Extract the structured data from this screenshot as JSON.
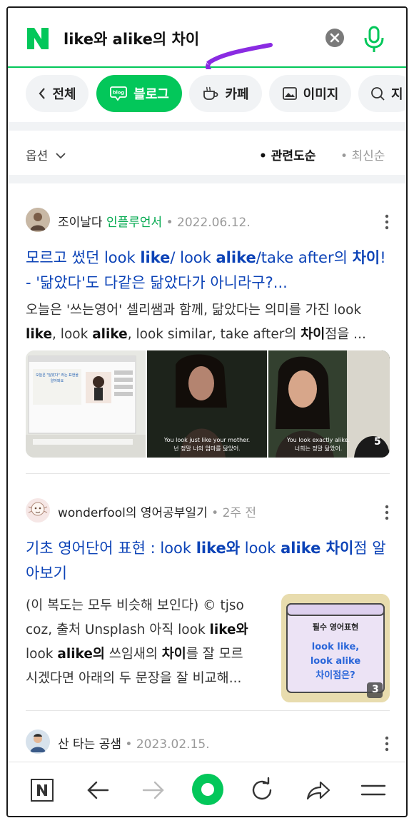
{
  "search": {
    "query": "like와 alike의 차이"
  },
  "tabs": [
    {
      "label": "전체",
      "icon": "chevron-left-icon"
    },
    {
      "label": "블로그",
      "icon": "blog-icon",
      "icon_text": "blog"
    },
    {
      "label": "카페",
      "icon": "cafe-icon"
    },
    {
      "label": "이미지",
      "icon": "image-icon"
    },
    {
      "label": "지",
      "icon": "search-icon"
    }
  ],
  "options": {
    "label": "옵션",
    "sort_relevance": "관련도순",
    "sort_recent": "최신순"
  },
  "results": [
    {
      "author": "조이날다",
      "badge": "인플루언서",
      "date": "2022.06.12.",
      "title_parts": [
        "모르고 썼던 look ",
        "like",
        "/ look ",
        "alike",
        "/take after의 ",
        "차이",
        "! - '닮았다'도 다같은 닮았다가 아니라구?..."
      ],
      "desc_parts": [
        "오늘은 '쓰는영어' 셀리쌤과 함께, 닮았다는 의미를 가진 look ",
        "like",
        ", look ",
        "alike",
        ", look similar, take after의 ",
        "차이",
        "점을 ..."
      ],
      "image_count": "5",
      "captions": [
        "You look just like your mother.",
        "넌 정말 너의 엄마를 닮았어.",
        "You look exactly alike.",
        "너희는 정말 닮았어."
      ],
      "slide_text": [
        "오늘은 \"닮았다\" 라는 표현을",
        "알아봐요"
      ]
    },
    {
      "author": "wonderfool의 영어공부일기",
      "date": "2주 전",
      "title_parts": [
        "기초 영어단어 표현 : look ",
        "like와",
        " look ",
        "alike 차이",
        "점 알아보기"
      ],
      "desc_lines": [
        [
          "(이 복도는 모두 비슷해 보인다) © tjso"
        ],
        [
          "coz, 출처 Unsplash 아직 look ",
          "like와"
        ],
        [
          "look ",
          "alike의",
          " 쓰임새의 ",
          "차이",
          "를 잘 모르"
        ],
        [
          "시겠다면 아래의 두 문장을 잘 비교해..."
        ]
      ],
      "card_header": "필수 영어표현",
      "card_line1": "look like,",
      "card_line2": "look alike",
      "card_line3": "차이점은?",
      "image_count": "3"
    },
    {
      "author": "산 타는 공샘",
      "date": "2023.02.15."
    }
  ],
  "colors": {
    "brand_green": "#03c75a",
    "link_blue": "#0c43b7",
    "scribble_purple": "#8a2be2"
  }
}
